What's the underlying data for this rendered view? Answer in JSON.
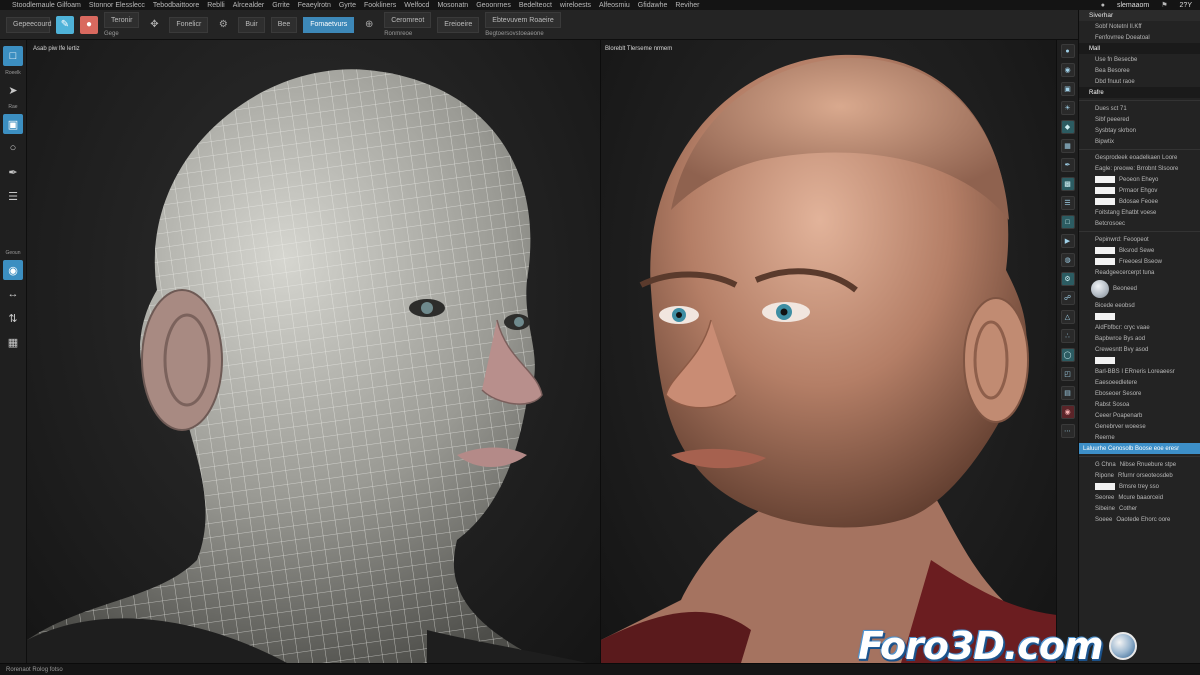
{
  "menubar": {
    "items": [
      "Stoodlemaule Gilfoam",
      "Stonnor Elesslecc",
      "Tebodbaittoore",
      "Reblli",
      "Alrcealder",
      "Grrite",
      "Feaeylrotn",
      "Gyrte",
      "Fookliners",
      "Welfocd",
      "Mosonatn",
      "Geoonrnes",
      "Bedelteoct",
      "wireloests",
      "Alfeosmiu",
      "Gfidawhe",
      "Reviher"
    ],
    "user_label": "slemaaom",
    "counter": "2?Y"
  },
  "toolbar": {
    "mode_label": "Gepeecourd",
    "btn_a": "Teronir",
    "btn_b": "Fonelicr",
    "btn_c": "Buir",
    "btn_d": "Bee",
    "btn_e": "Fomaetvurs",
    "btn_f": "Ceromreot",
    "btn_g": "Ereioeire",
    "field_label": "Ebtevuvem Roaeire",
    "field_sub": "Begtoersovstoeaeone",
    "sub_a": "Gege",
    "sub_b": "Ronmreoe"
  },
  "leftbar": {
    "top_label": "Roeelk",
    "label_b": "Rae",
    "label_c": "Geoun"
  },
  "viewport_left": {
    "label": "Asab piw lfe lertiz"
  },
  "viewport_right": {
    "label": "Bloreblt Tlerseme nrmem"
  },
  "panel": {
    "header": "Siverhar",
    "rows_a": [
      "Sobf Notetnl Il.Kff",
      "Fenfovrree Doeatoal"
    ],
    "section_mall": "Mall",
    "rows_b": [
      "Use fn Besecbe",
      "Bea Besoree",
      "Dbd fnuut raoe"
    ],
    "section_selected": "Rafre",
    "rows_c": [
      "Dues sct 71",
      "Sibf peeered",
      "Sysbtay skrbon",
      "Bipwtix"
    ],
    "group_label": "Gesprodeek eoadelkaen Loore",
    "rows_d": [
      "Eagle: preowe: Brrobnt Slsoore",
      "Peoeon Eheyo",
      "Prmaor Ehgov",
      "Bdosae Feoee",
      "Foitstang Ehatbt voese"
    ],
    "item_bsrs": "Betcrosoec",
    "rows_e": [
      "Pepinwrd: Feoopeot",
      "Bksrod Sewe",
      "Freeoesl Bseow",
      "Readgeecercerpt tuna"
    ],
    "rows_f": [
      "Beoneed",
      "Bicede eeobsd",
      "AldFbfbcr: cryc vaae",
      "Bapbwrce Bys aod",
      "Crewesntt Bvy asod"
    ],
    "row_highlight": "Barl-BBS I ERneris Loreaeesr",
    "rows_g": [
      "Eaesoeedletere",
      "Eboseoer Sesore",
      "Rabst Sosoa",
      "Ceeer Poapenarb",
      "Genebrver woeese",
      "Reerne"
    ],
    "highlight_bar": "Laluurhe Cenosolb Boose eoe eresr",
    "rows_h": [
      "Nibse Rnuebure stpe",
      "Rfurnr orseoteosdeb",
      "Bmsre trey sso",
      "Mcure baaorceid",
      "Cother",
      "Oaotede Ehorc oore"
    ],
    "rows_h_labels": [
      "G Chna",
      "Ripone",
      "",
      "Seoree",
      "Sibeine",
      "Soeee"
    ]
  },
  "status": {
    "text": "Rorenaot Rolog fotso"
  },
  "watermark": {
    "text": "Foro3D.com"
  }
}
